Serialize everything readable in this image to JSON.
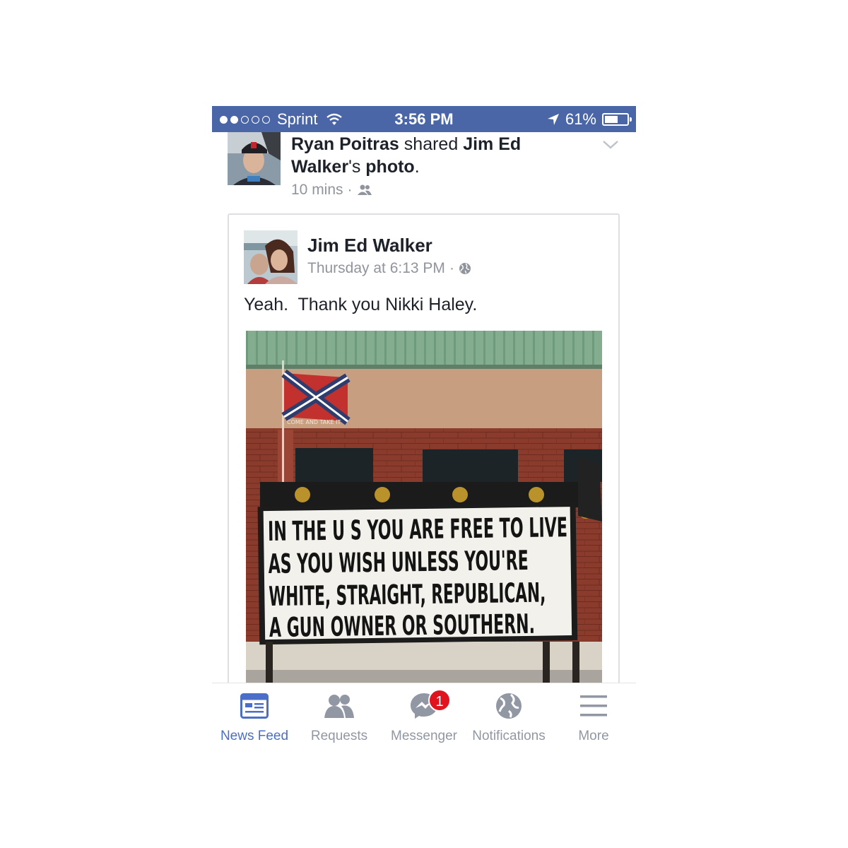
{
  "status_bar": {
    "carrier": "Sprint",
    "time": "3:56 PM",
    "battery": "61%",
    "battery_level": 0.61,
    "signal_bars": 2
  },
  "share_header": {
    "sharer_name": "Ryan Poitras",
    "action": " shared ",
    "owner_name": "Jim Ed Walker",
    "owner_suffix": "'s ",
    "object": "photo",
    "end": ".",
    "time": "10 mins",
    "separator": "·",
    "audience_icon": "friends-icon"
  },
  "post": {
    "author": "Jim Ed Walker",
    "timestamp": "Thursday at 6:13 PM",
    "separator": "·",
    "audience_icon": "globe-icon",
    "text": "Yeah.  Thank you Nikki Haley."
  },
  "photo": {
    "flag_text": "COME AND TAKE IT",
    "sign_lines": [
      "IN THE U S YOU ARE FREE TO LIVE",
      "AS YOU WISH UNLESS YOU'RE",
      "WHITE, STRAIGHT, REPUBLICAN,",
      "A GUN OWNER OR SOUTHERN."
    ]
  },
  "tab_bar": {
    "tabs": [
      {
        "label": "News Feed",
        "icon": "news-feed-icon",
        "active": true
      },
      {
        "label": "Requests",
        "icon": "friend-requests-icon"
      },
      {
        "label": "Messenger",
        "icon": "messenger-icon",
        "badge": "1"
      },
      {
        "label": "Notifications",
        "icon": "globe-notifications-icon"
      },
      {
        "label": "More",
        "icon": "menu-icon"
      }
    ]
  },
  "colors": {
    "status_bar": "#4a66a6",
    "active_tab": "#4b6ec9",
    "inactive_tab": "#9197a3",
    "badge": "#e0141e"
  }
}
